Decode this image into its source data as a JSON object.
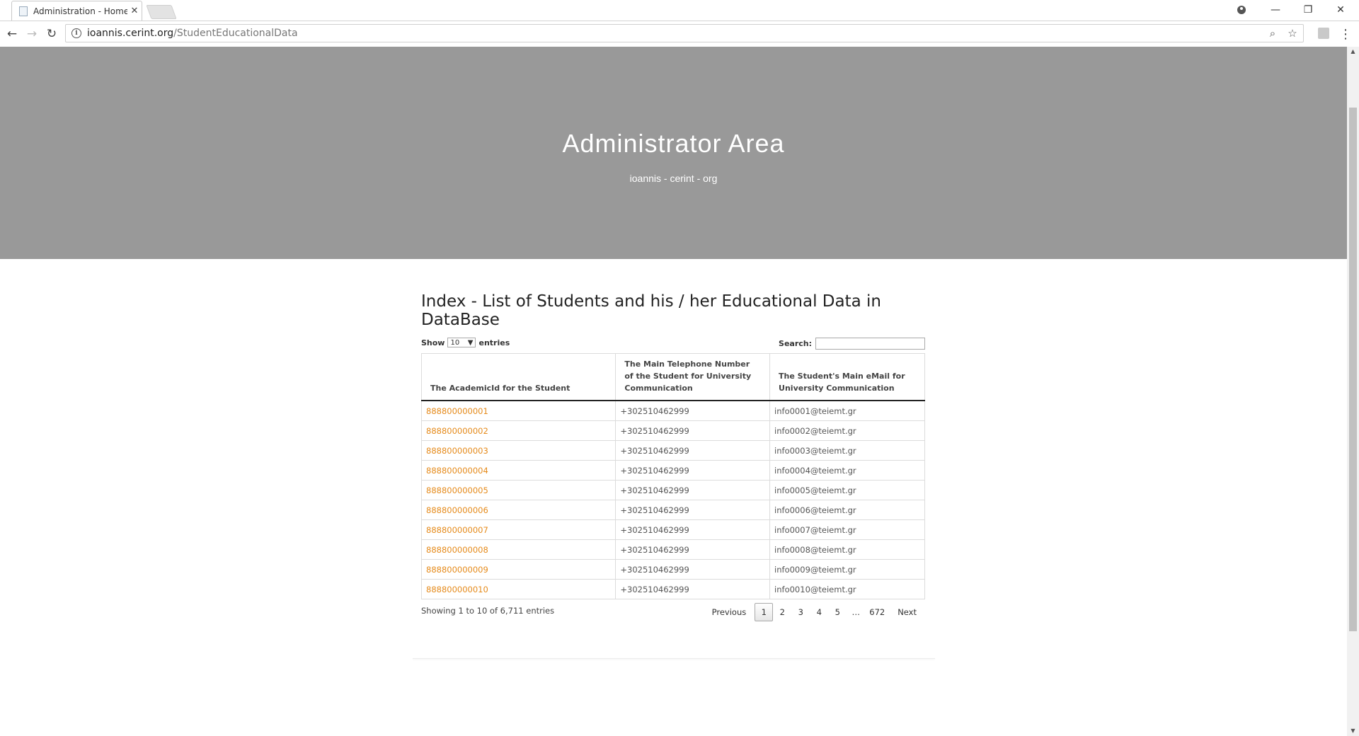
{
  "browser": {
    "tab_title": "Administration - Home -",
    "url_host": "ioannis.cerint.org",
    "url_path": "/StudentEducationalData"
  },
  "hero": {
    "title": "Administrator Area",
    "subtitle": "ioannis - cerint - org"
  },
  "page": {
    "heading": "Index - List of Students and his / her Educational Data in DataBase",
    "show_label": "Show",
    "entries_label": "entries",
    "length_value": "10",
    "search_label": "Search:",
    "search_value": ""
  },
  "table": {
    "headers": [
      "The AcademicId for the Student",
      "The Main Telephone Number of the Student for University Communication",
      "The Student's Main eMail for University Communication"
    ],
    "rows": [
      [
        "888800000001",
        "+302510462999",
        "info0001@teiemt.gr"
      ],
      [
        "888800000002",
        "+302510462999",
        "info0002@teiemt.gr"
      ],
      [
        "888800000003",
        "+302510462999",
        "info0003@teiemt.gr"
      ],
      [
        "888800000004",
        "+302510462999",
        "info0004@teiemt.gr"
      ],
      [
        "888800000005",
        "+302510462999",
        "info0005@teiemt.gr"
      ],
      [
        "888800000006",
        "+302510462999",
        "info0006@teiemt.gr"
      ],
      [
        "888800000007",
        "+302510462999",
        "info0007@teiemt.gr"
      ],
      [
        "888800000008",
        "+302510462999",
        "info0008@teiemt.gr"
      ],
      [
        "888800000009",
        "+302510462999",
        "info0009@teiemt.gr"
      ],
      [
        "888800000010",
        "+302510462999",
        "info0010@teiemt.gr"
      ]
    ]
  },
  "footer": {
    "info": "Showing 1 to 10 of 6,711 entries",
    "previous": "Previous",
    "next": "Next",
    "pages": [
      "1",
      "2",
      "3",
      "4",
      "5",
      "…",
      "672"
    ],
    "current_page": "1"
  },
  "colors": {
    "hero_bg": "#999999",
    "link": "#e58a1a"
  }
}
